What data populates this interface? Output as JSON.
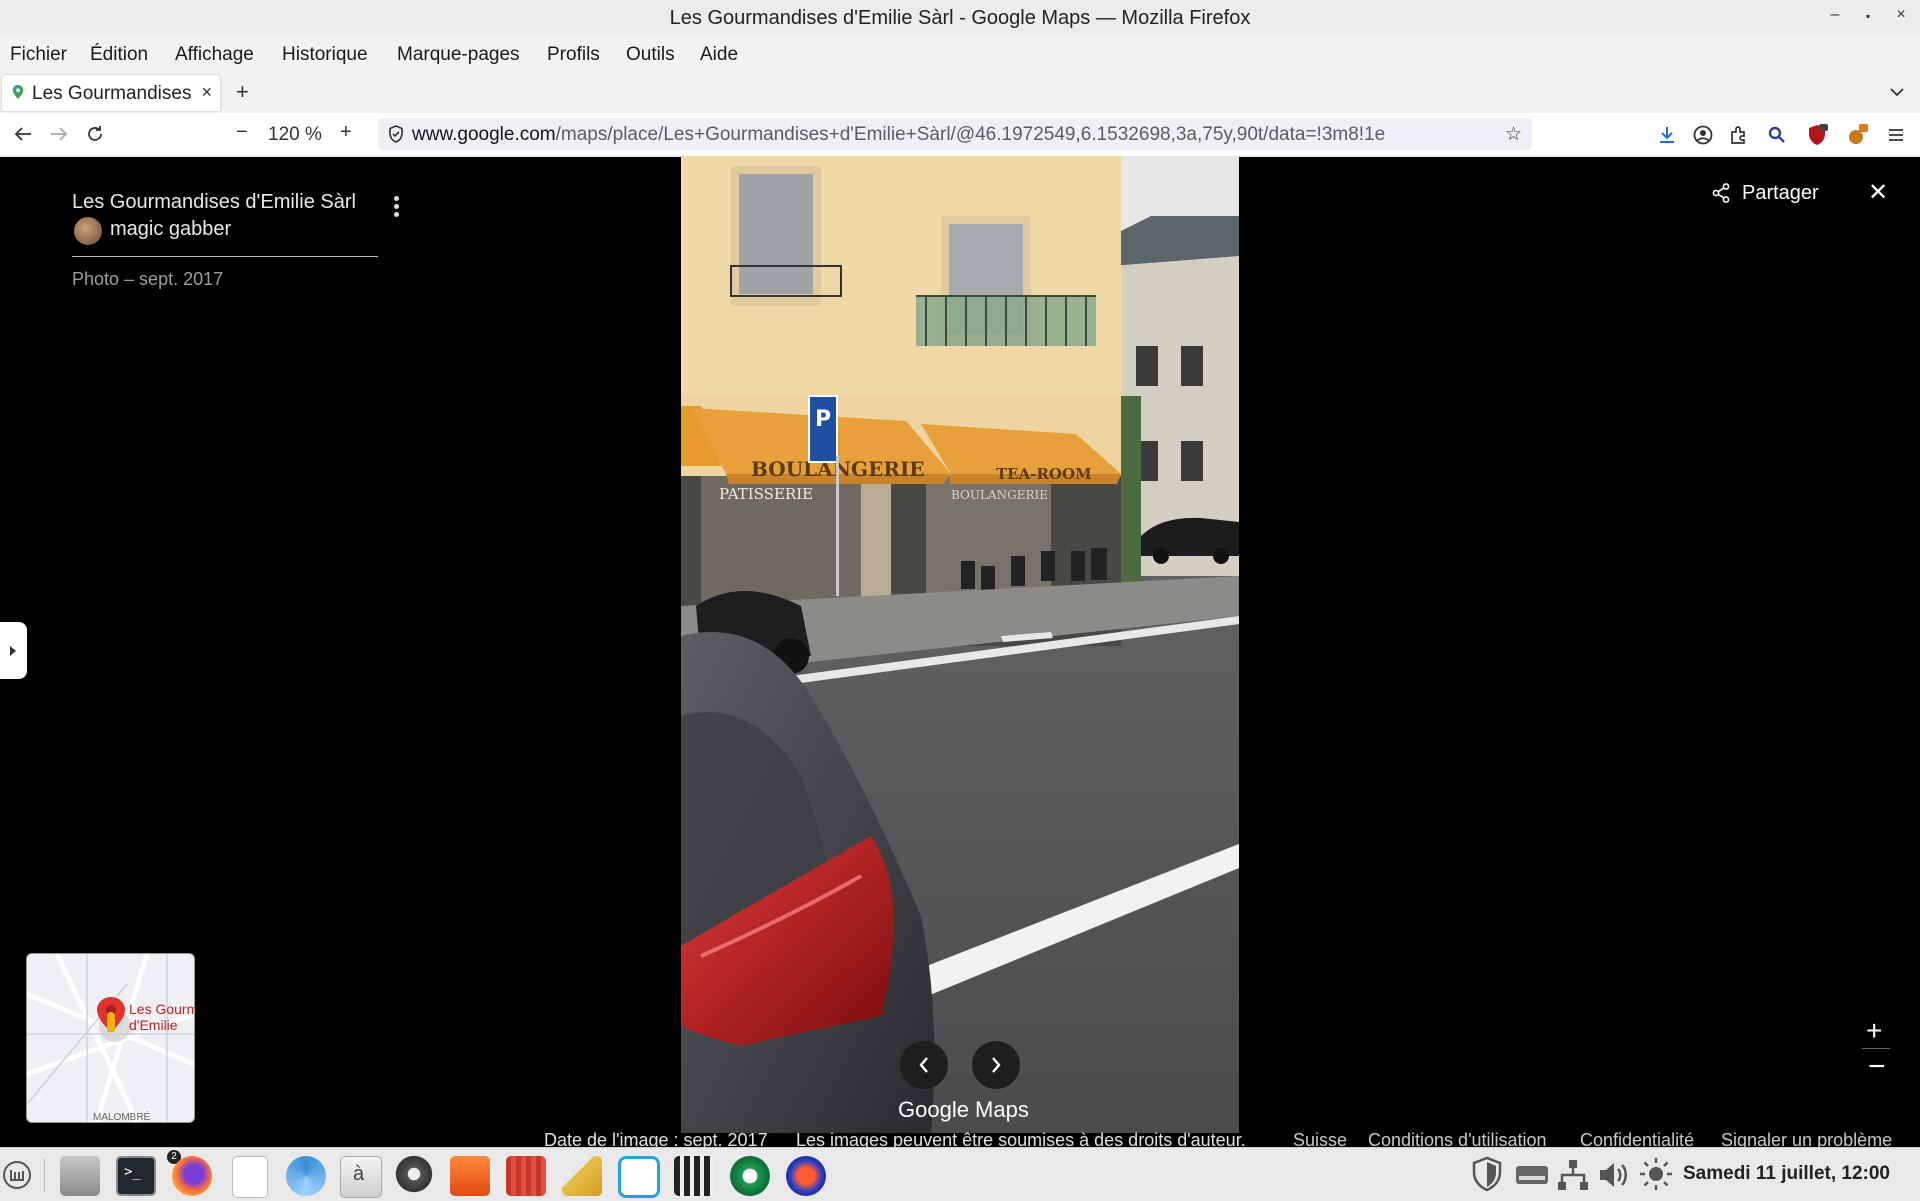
{
  "window": {
    "title": "Les Gourmandises d'Emilie Sàrl - Google Maps — Mozilla Firefox",
    "controls": [
      "–",
      "▪",
      "×"
    ]
  },
  "menu": [
    "Fichier",
    "Édition",
    "Affichage",
    "Historique",
    "Marque-pages",
    "Profils",
    "Outils",
    "Aide"
  ],
  "tab": {
    "label": "Les Gourmandises d'Emilie Sàrl",
    "close": "×",
    "new": "+"
  },
  "nav": {
    "zoom_out": "−",
    "zoom_level": "120 %",
    "zoom_in": "+",
    "url_host": "www.google.com",
    "url_path": "/maps/place/Les+Gourmandises+d'Emilie+Sàrl/@46.1972549,6.1532698,3a,75y,90t/data=!3m8!1e"
  },
  "panel": {
    "place_title": "Les Gourmandises d'Emilie Sàrl",
    "author": "magic gabber",
    "photo_date": "Photo – sept. 2017"
  },
  "actions": {
    "share": "Partager",
    "close": "✕"
  },
  "photo": {
    "awning_left": "BOULANGERIE",
    "awning_right": "TEA-ROOM",
    "window_left": "PATISSERIE",
    "window_right": "BOULANGERIE",
    "parking_sign": "P"
  },
  "minimap": {
    "label_line1": "Les Gourmandises",
    "label_line2": "d'Emilie",
    "street": "MALOMBRÉ"
  },
  "viewer": {
    "prev": "‹",
    "next": "›",
    "logo": "Google Maps",
    "zoom_in": "+",
    "zoom_out": "−"
  },
  "footer": {
    "image_date": "Date de l'image : sept. 2017",
    "rights": "Les images peuvent être soumises à des droits d'auteur.",
    "country": "Suisse",
    "terms": "Conditions d'utilisation",
    "privacy": "Confidentialité",
    "report": "Signaler un problème"
  },
  "taskbar": {
    "badge": "2",
    "glyph": "à",
    "clock": "Samedi 11 juillet, 12:00"
  }
}
